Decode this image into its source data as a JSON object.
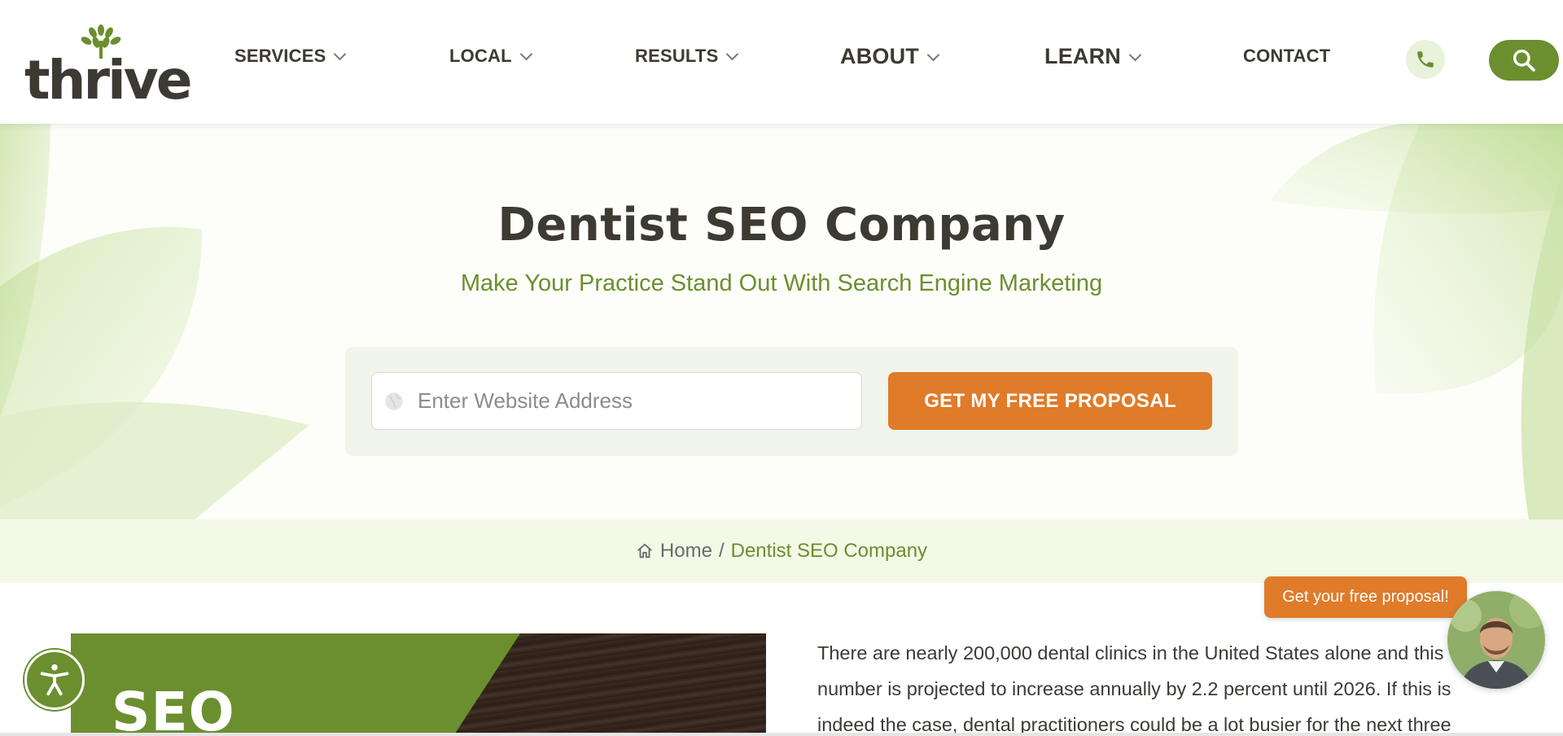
{
  "brand": {
    "logo_text": "thrive"
  },
  "nav": {
    "items": [
      {
        "label": "SERVICES"
      },
      {
        "label": "LOCAL"
      },
      {
        "label": "RESULTS"
      },
      {
        "label": "ABOUT"
      },
      {
        "label": "LEARN"
      },
      {
        "label": "CONTACT"
      }
    ],
    "phone_icon": "phone-icon",
    "search_icon": "search-icon"
  },
  "hero": {
    "title": "Dentist SEO Company",
    "subtitle": "Make Your Practice Stand Out With Search Engine Marketing",
    "input_placeholder": "Enter Website Address",
    "input_icon": "globe-icon",
    "cta_label": "GET MY FREE PROPOSAL"
  },
  "breadcrumb": {
    "home_icon": "home-icon",
    "home_label": "Home",
    "separator": "/",
    "current": "Dentist SEO Company"
  },
  "content": {
    "image_label": "SEO",
    "paragraph": "There are nearly 200,000 dental clinics in the United States alone and this number is projected to increase annually by 2.2 percent until 2026. If this is indeed the case, dental practitioners could be a lot busier for the next three"
  },
  "chat": {
    "bubble_label": "Get your free proposal!"
  },
  "accessibility": {
    "icon": "accessibility-icon"
  },
  "colors": {
    "brand_green": "#6b8f2f",
    "accent_orange": "#e07b2a",
    "text_dark": "#3d3a33",
    "breadcrumb_bg": "#f3f9e6"
  }
}
